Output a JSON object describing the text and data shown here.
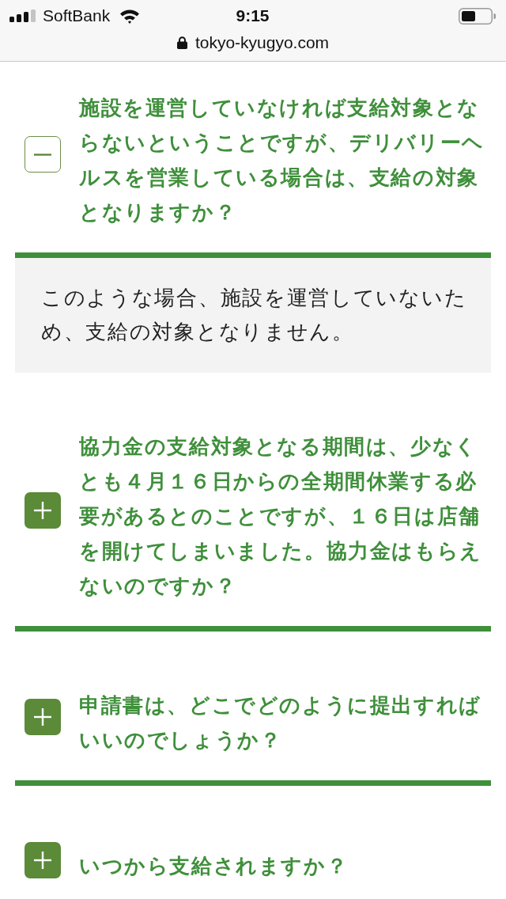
{
  "status_bar": {
    "carrier": "SoftBank",
    "time": "9:15"
  },
  "address_bar": {
    "url": "tokyo-kyugyo.com"
  },
  "faq": [
    {
      "question": "施設を運営していなければ支給対象とならないということですが、デリバリーヘルスを営業している場合は、支給の対象となりますか？",
      "expanded": true,
      "answer": "このような場合、施設を運営していないため、支給の対象となりません。"
    },
    {
      "question": "協力金の支給対象となる期間は、少なくとも４月１６日からの全期間休業する必要があるとのことですが、１６日は店舗を開けてしまいました。協力金はもらえないのですか？",
      "expanded": false
    },
    {
      "question": "申請書は、どこでどのように提出すればいいのでしょうか？",
      "expanded": false
    },
    {
      "question": "いつから支給されますか？",
      "expanded": false
    }
  ]
}
